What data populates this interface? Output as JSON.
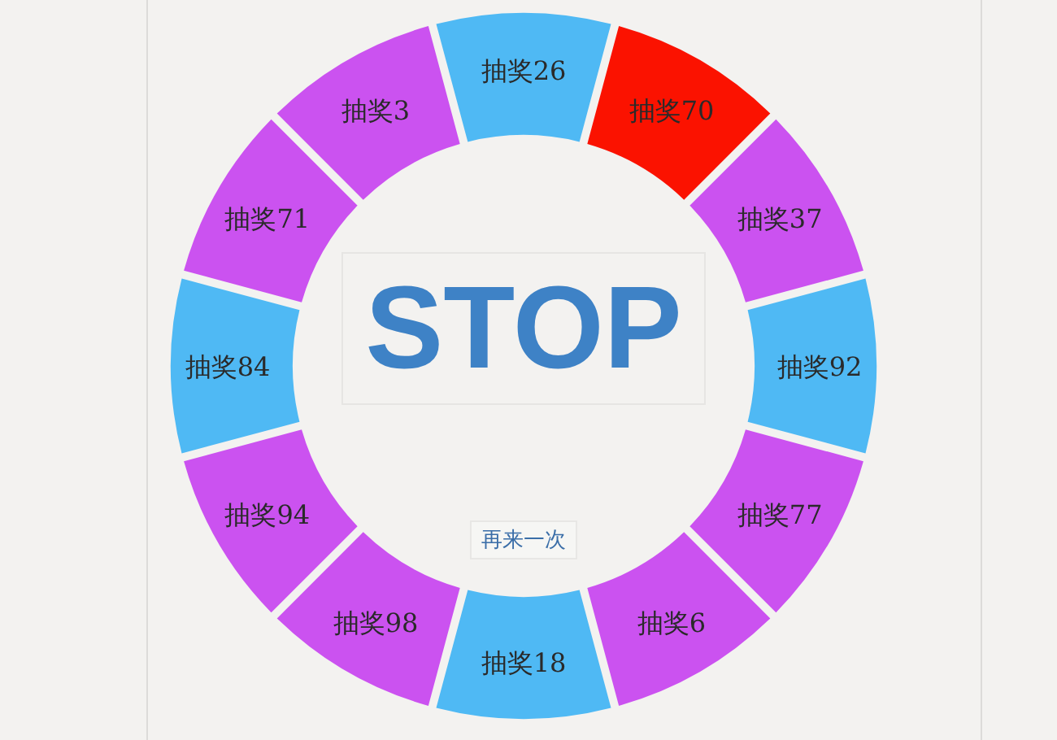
{
  "wheel": {
    "segments": [
      {
        "label": "抽奖26",
        "color": "#4fb9f4"
      },
      {
        "label": "抽奖3",
        "color": "#cb52f0"
      },
      {
        "label": "抽奖70",
        "color": "#fb1200"
      },
      {
        "label": "抽奖71",
        "color": "#cb52f0"
      },
      {
        "label": "抽奖37",
        "color": "#cb52f0"
      },
      {
        "label": "抽奖84",
        "color": "#4fb9f4"
      },
      {
        "label": "抽奖92",
        "color": "#4fb9f4"
      },
      {
        "label": "抽奖94",
        "color": "#cb52f0"
      },
      {
        "label": "抽奖77",
        "color": "#cb52f0"
      },
      {
        "label": "抽奖98",
        "color": "#cb52f0"
      },
      {
        "label": "抽奖6",
        "color": "#cb52f0"
      },
      {
        "label": "抽奖18",
        "color": "#4fb9f4"
      }
    ],
    "center_title": "STOP",
    "retry_button": "再来一次"
  }
}
